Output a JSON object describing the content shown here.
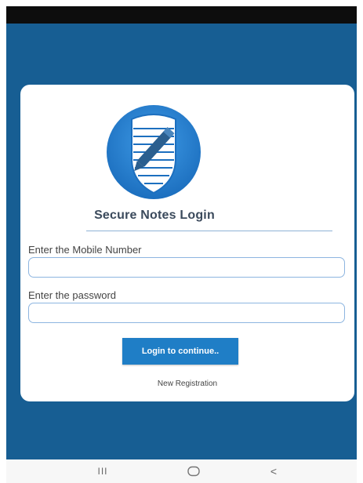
{
  "app": {
    "title": "Secure Notes Login",
    "colors": {
      "background": "#175e93",
      "accent": "#1f7ec6",
      "input_border": "#8db5e0",
      "logo_circle": "#2b88d6"
    }
  },
  "logo": {
    "icon": "shield-notepad-pencil-icon"
  },
  "form": {
    "mobile_label": "Enter the Mobile Number",
    "mobile_value": "",
    "password_label": "Enter the password",
    "password_value": ""
  },
  "actions": {
    "login_label": "Login to continue..",
    "register_label": "New Registration"
  },
  "navbar": {
    "recents_icon": "III",
    "home_icon": "home-icon",
    "back_icon": "<"
  }
}
